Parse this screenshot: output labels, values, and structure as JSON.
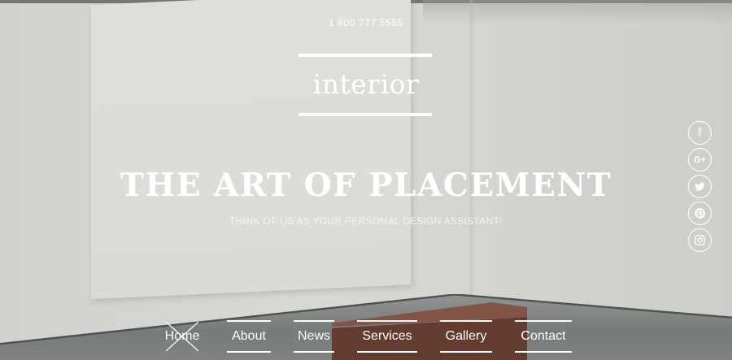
{
  "header": {
    "phone": "1 800 777 5555",
    "logo": "interior"
  },
  "hero": {
    "headline": "THE ART OF PLACEMENT",
    "tagline": "THINK OF US AS YOUR PERSONAL DESIGN ASSISTANT!"
  },
  "social": [
    {
      "name": "facebook",
      "glyph": "f"
    },
    {
      "name": "google-plus",
      "glyph": "G+"
    },
    {
      "name": "twitter",
      "glyph": ""
    },
    {
      "name": "pinterest",
      "glyph": ""
    },
    {
      "name": "instagram",
      "glyph": ""
    }
  ],
  "nav": {
    "items": [
      {
        "label": "Home",
        "active": true
      },
      {
        "label": "About"
      },
      {
        "label": "News"
      },
      {
        "label": "Services"
      },
      {
        "label": "Gallery"
      },
      {
        "label": "Contact"
      }
    ]
  },
  "colors": {
    "text": "#ffffff",
    "wall": "#d4d4d0",
    "bench": "#5b2f22",
    "floor": "#6f7272"
  }
}
